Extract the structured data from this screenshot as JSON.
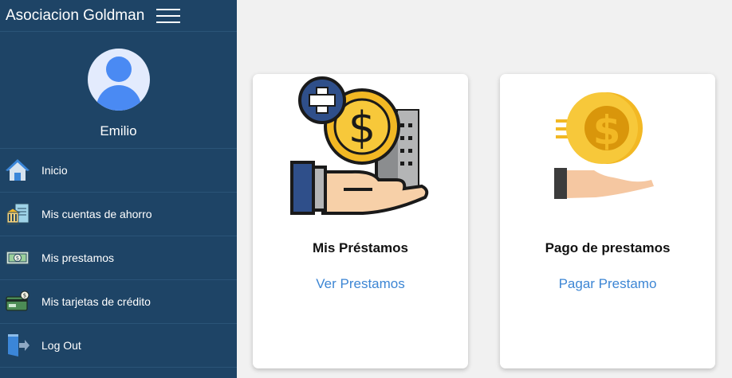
{
  "brand": {
    "title": "Asociacion Goldman"
  },
  "profile": {
    "name": "Emilio"
  },
  "nav": {
    "items": [
      {
        "label": "Inicio",
        "icon": "home-icon"
      },
      {
        "label": "Mis cuentas de ahorro",
        "icon": "bank-icon"
      },
      {
        "label": "Mis prestamos",
        "icon": "banknote-icon"
      },
      {
        "label": "Mis tarjetas de crédito",
        "icon": "credit-card-icon"
      },
      {
        "label": "Log Out",
        "icon": "logout-icon"
      }
    ]
  },
  "cards": [
    {
      "title": "Mis Préstamos",
      "link": "Ver Prestamos",
      "icon": "loan-hand-coin-icon"
    },
    {
      "title": "Pago de prestamos",
      "link": "Pagar Prestamo",
      "icon": "hand-coin-payment-icon"
    }
  ],
  "colors": {
    "sidebar": "#1e4466",
    "background": "#f1f1f1",
    "link": "#3d86d4"
  }
}
